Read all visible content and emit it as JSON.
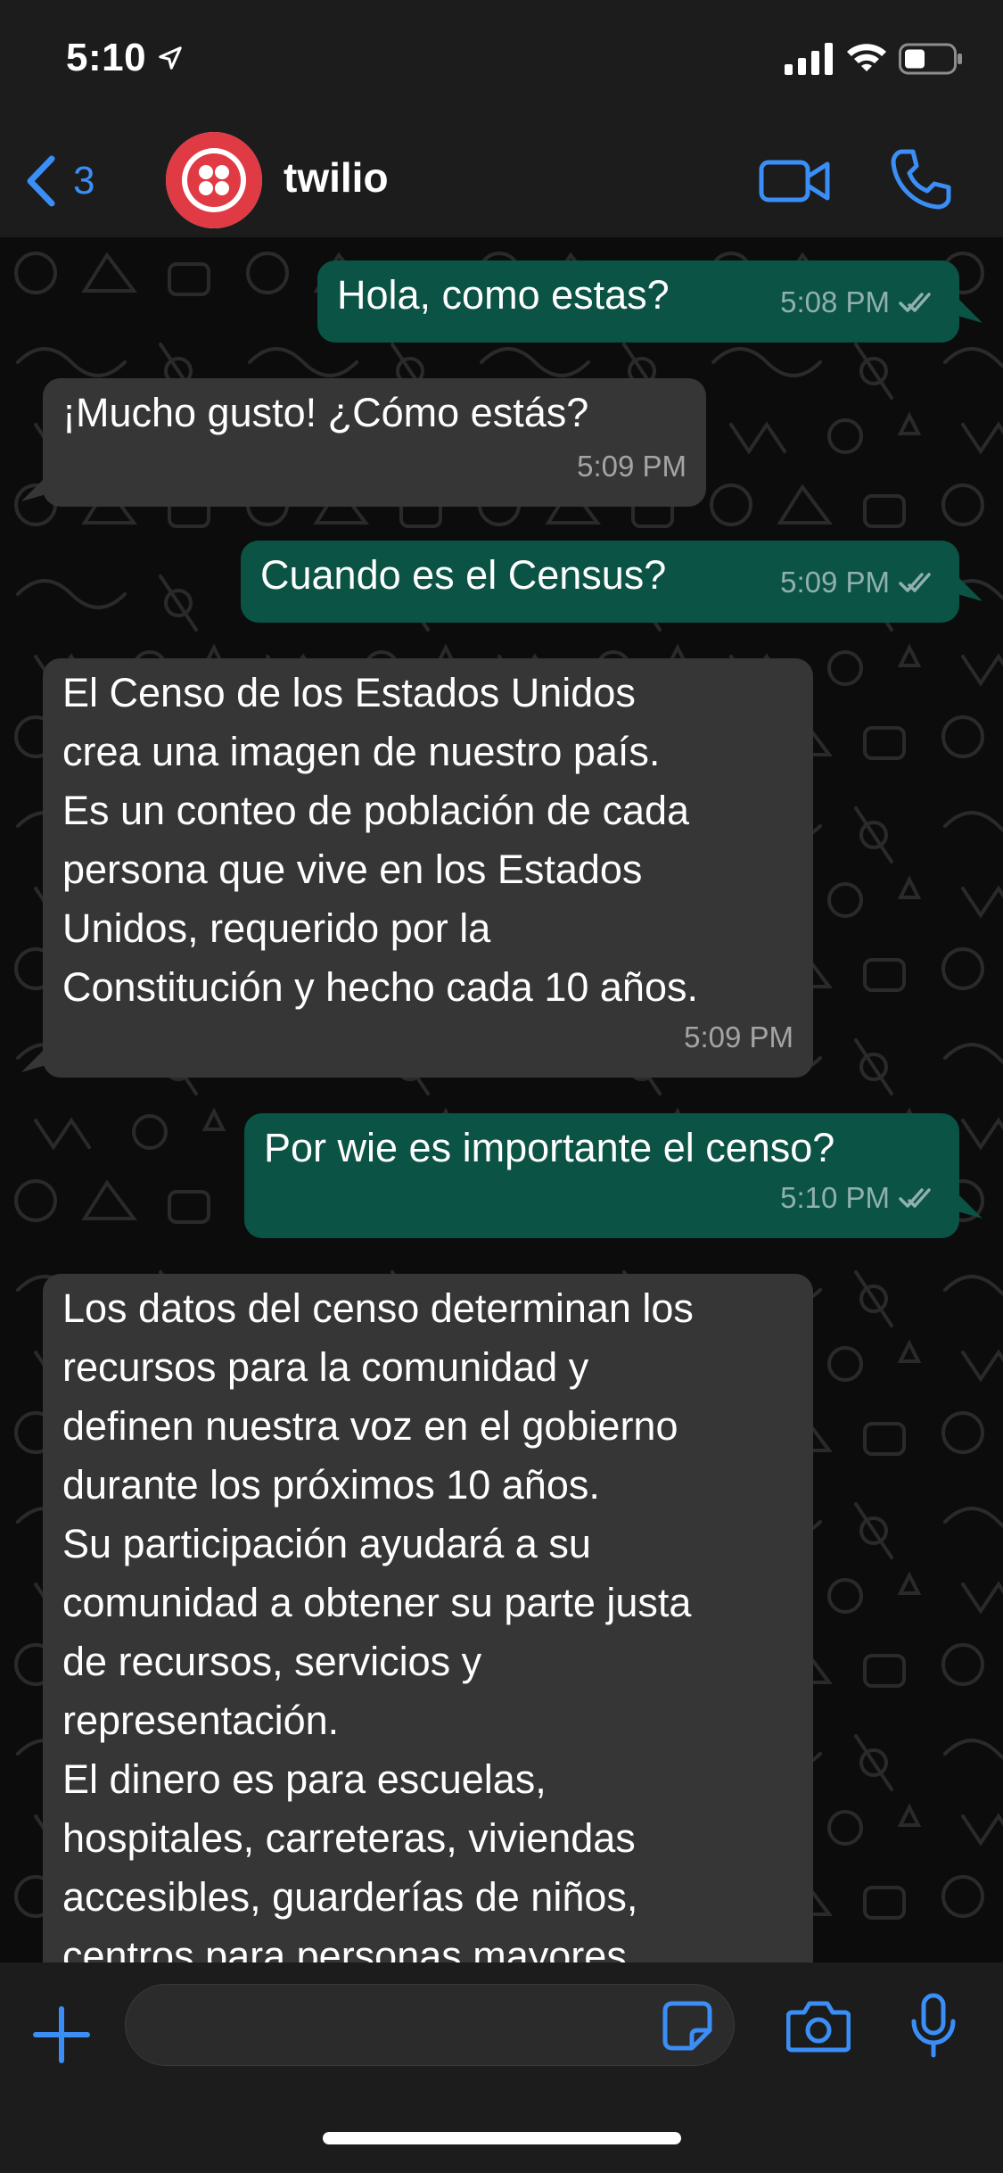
{
  "status_bar": {
    "time": "5:10"
  },
  "header": {
    "back_count": "3",
    "contact_name": "twilio"
  },
  "colors": {
    "accent": "#3a8ef6",
    "outgoing_bubble": "#0b5345",
    "incoming_bubble": "#363636",
    "avatar_brand": "#e03a44"
  },
  "icons": {
    "back": "chevron-left-icon",
    "avatar": "twilio-logo",
    "video": "video-camera-icon",
    "call": "phone-icon",
    "plus": "plus-icon",
    "sticker": "sticker-icon",
    "camera": "camera-icon",
    "mic": "microphone-icon",
    "read_status": "double-check-icon"
  },
  "messages": [
    {
      "direction": "out",
      "text": "Hola, como estas?",
      "time": "5:08 PM",
      "read": true
    },
    {
      "direction": "in",
      "text": "¡Mucho gusto! ¿Cómo estás?",
      "time": "5:09 PM"
    },
    {
      "direction": "out",
      "text": "Cuando es el Census?",
      "time": "5:09 PM",
      "read": true
    },
    {
      "direction": "in",
      "text": "El Censo de los Estados Unidos\ncrea una imagen de nuestro país.\nEs un conteo de población de cada\npersona que vive en los Estados\nUnidos, requerido por la\nConstitución y hecho cada 10 años.",
      "time": "5:09 PM"
    },
    {
      "direction": "out",
      "text": "Por wie es importante el censo?",
      "time": "5:10 PM",
      "read": true
    },
    {
      "direction": "in",
      "text": "Los datos del censo determinan los\nrecursos para la comunidad y\ndefinen nuestra voz en el gobierno\ndurante los próximos 10 años.\nSu participación ayudará a su\ncomunidad a obtener su parte justa\nde recursos, servicios y\nrepresentación.\nEl dinero es para escuelas,\nhospitales, carreteras, viviendas\naccesibles, guarderías de niños,\ncentros para personas mayores,"
    }
  ],
  "composer": {
    "input_value": "",
    "input_placeholder": ""
  }
}
